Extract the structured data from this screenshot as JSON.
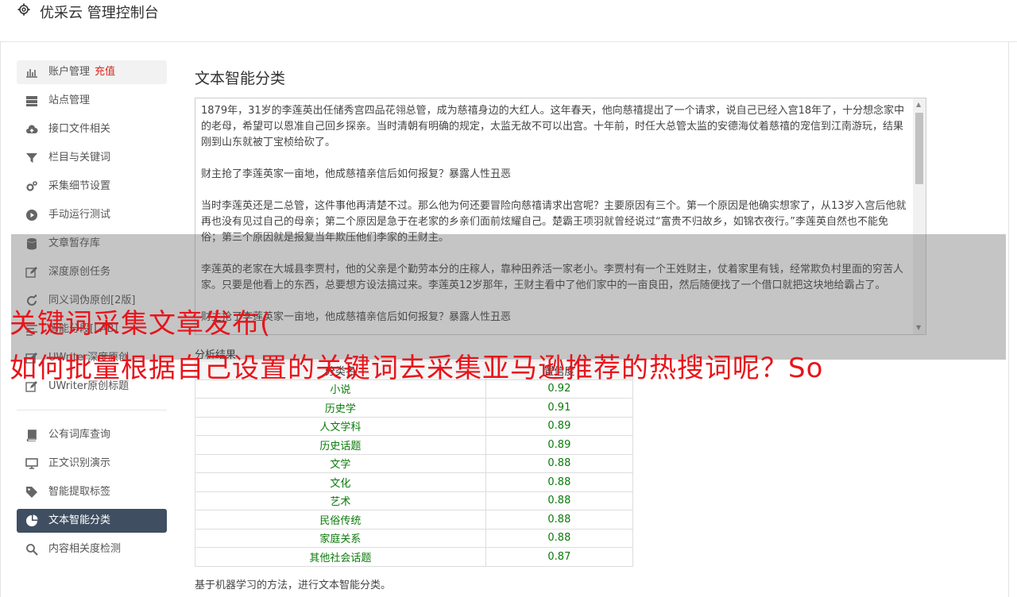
{
  "header": {
    "title": "优采云 管理控制台",
    "icon": "gear-icon"
  },
  "sidebar": {
    "items": [
      {
        "label": "账户管理",
        "extra": "充值",
        "icon": "bar-chart-icon"
      },
      {
        "label": "站点管理",
        "icon": "server-icon"
      },
      {
        "label": "接口文件相关",
        "icon": "cloud-upload-icon"
      },
      {
        "label": "栏目与关键词",
        "icon": "filter-icon"
      },
      {
        "label": "采集细节设置",
        "icon": "cogs-icon"
      },
      {
        "label": "手动运行测试",
        "icon": "play-icon"
      },
      {
        "label": "文章暂存库",
        "icon": "database-icon"
      },
      {
        "label": "深度原创任务",
        "icon": "edit-icon"
      },
      {
        "label": "同义词伪原创[2版]",
        "icon": "refresh-icon"
      },
      {
        "label": "智能分段[LAB]",
        "icon": "align-icon"
      },
      {
        "label": "UWriter深度原创",
        "icon": "edit-icon"
      },
      {
        "label": "UWriter原创标题",
        "icon": "edit-icon"
      },
      {
        "label": "公有词库查询",
        "icon": "book-icon"
      },
      {
        "label": "正文识别演示",
        "icon": "monitor-icon"
      },
      {
        "label": "智能提取标签",
        "icon": "tag-icon"
      },
      {
        "label": "文本智能分类",
        "icon": "pie-chart-icon"
      },
      {
        "label": "内容相关度检测",
        "icon": "search-icon"
      }
    ]
  },
  "main": {
    "title": "文本智能分类",
    "text_paragraphs": [
      "1879年，31岁的李莲英出任储秀宫四品花翎总管，成为慈禧身边的大红人。这年春天，他向慈禧提出了一个请求，说自己已经入宫18年了，十分想念家中的老母，希望可以恩准自己回乡探亲。当时清朝有明确的规定，太监无故不可以出宫。十年前，时任大总管太监的安德海仗着慈禧的宠信到江南游玩，结果刚到山东就被丁宝桢给砍了。",
      "财主抢了李莲英家一亩地，他成慈禧亲信后如何报复？暴露人性丑恶",
      "当时李莲英还是二总管，这件事他再清楚不过。那么他为何还要冒险向慈禧请求出宫呢？主要原因有三个。第一个原因是他确实想家了，从13岁入宫后他就再也没有见过自己的母亲；第二个原因是急于在老家的乡亲们面前炫耀自己。楚霸王项羽就曾经说过“富贵不归故乡，如锦衣夜行。”李莲英自然也不能免俗；第三个原因就是报复当年欺压他们李家的王财主。",
      "李莲英的老家在大城县李贾村，他的父亲是个勤劳本分的庄稼人，靠种田养活一家老小。李贾村有一个王姓财主，仗着家里有钱，经常欺负村里面的穷苦人家。只要是他看上的东西，总要想方设法搞过来。李莲英12岁那年，王财主看中了他们家中的一亩良田，然后随便找了一个借口就把这块地给霸占了。",
      "财主抢了李莲英家一亩地，他成慈禧亲信后如何报复？暴露人性丑恶"
    ],
    "result_label": "分析结果",
    "table_headers": [
      "分类名",
      "置信度"
    ],
    "rows": [
      [
        "小说",
        "0.92"
      ],
      [
        "历史学",
        "0.91"
      ],
      [
        "人文学科",
        "0.89"
      ],
      [
        "历史话题",
        "0.89"
      ],
      [
        "文学",
        "0.88"
      ],
      [
        "文化",
        "0.88"
      ],
      [
        "艺术",
        "0.88"
      ],
      [
        "民俗传统",
        "0.88"
      ],
      [
        "家庭关系",
        "0.88"
      ],
      [
        "其他社会话题",
        "0.87"
      ]
    ],
    "footnote": "基于机器学习的方法，进行文本智能分类。"
  },
  "overlay": {
    "line1": "关键词采集文章发布(",
    "line2": "如何批量根据自己设置的关键词去采集亚马逊推荐的热搜词呢？So"
  },
  "colors": {
    "accent_red": "#e8141b",
    "active_nav": "#3f4f61",
    "value_green": "#0a7a0a"
  }
}
